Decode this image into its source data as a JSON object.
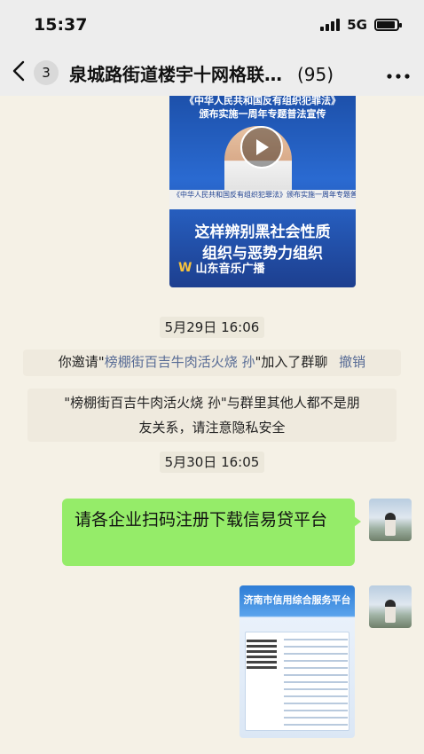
{
  "status_bar": {
    "time": "15:37",
    "network": "5G",
    "battery_level": 0.9,
    "signal_bars": 4
  },
  "nav": {
    "back_icon": "chevron-left-icon",
    "unread_count": "3",
    "title": "泉城路街道楼宇十网格联…",
    "member_count": "(95)",
    "more_icon": "more-dots-icon"
  },
  "messages": {
    "video": {
      "banner_line1": "《中华人民共和国反有组织犯罪法》",
      "banner_line2": "颁布实施一周年专题普法宣传",
      "strip_text": "《中华人民共和国反有组织犯罪法》颁布实施一周年专题普法宣传",
      "caption_line1": "这样辨别黑社会性质",
      "caption_line2": "组织与恶势力组织",
      "brand": "山东音乐广播",
      "play_icon": "play-icon"
    },
    "time_1": "5月29日 16:06",
    "invite_prefix": "你邀请\"",
    "invite_name": "榜棚街百吉牛肉活火烧 孙",
    "invite_suffix": "\"加入了群聊",
    "revoke_label": "撤销",
    "privacy_line1": "\"榜棚街百吉牛肉活火烧 孙\"与群里其他人都不是朋",
    "privacy_line2": "友关系，请注意隐私安全",
    "time_2": "5月30日 16:05",
    "text_message": "请各企业扫码注册下载信易贷平台",
    "poster_title": "济南市信用综合服务平台"
  },
  "colors": {
    "chat_background": "#f5f1e6",
    "sent_bubble": "#95ec69",
    "link": "#576b95"
  }
}
